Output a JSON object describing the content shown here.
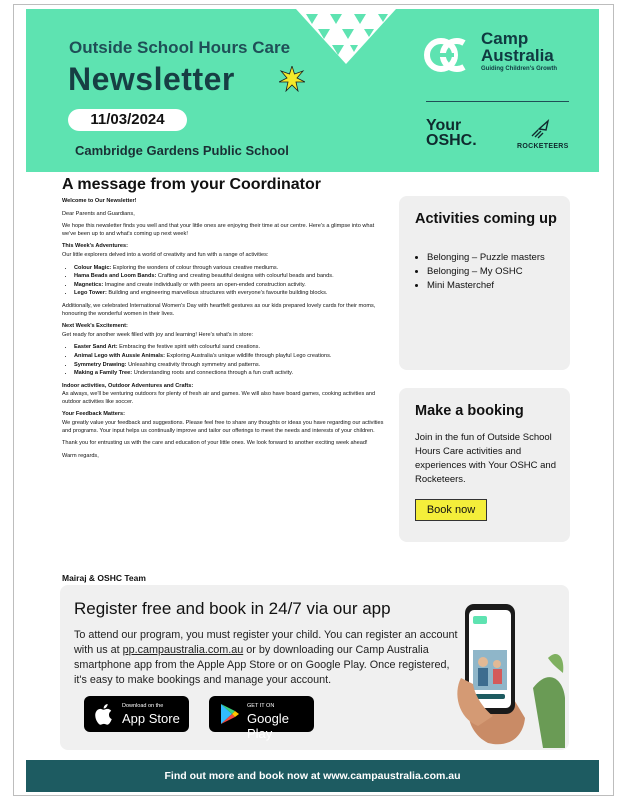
{
  "header": {
    "subtitle": "Outside School Hours Care",
    "title": "Newsletter",
    "date": "11/03/2024",
    "school": "Cambridge Gardens Public School",
    "brand_name_line1": "Camp",
    "brand_name_line2": "Australia",
    "brand_tagline": "Guiding Children's Growth",
    "your_oshc_line1": "Your",
    "your_oshc_line2": "OSHC.",
    "rocketeers": "ROCKETEERS",
    "bg_color": "#5ee3b1"
  },
  "coordinator": {
    "heading": "A message from your Coordinator",
    "welcome": "Welcome to Our Newsletter!",
    "greeting": "Dear Parents and Guardians,",
    "intro": "We hope this newsletter finds you well and that your little ones are enjoying their time at our centre. Here's a glimpse into what we've been up to and what's coming up next week!",
    "week_heading": "This Week's Adventures:",
    "week_intro": "Our little explorers delved into a world of creativity and fun with a range of activities:",
    "week_items": [
      {
        "title": "Colour Magic:",
        "text": " Exploring the wonders of colour through various creative mediums."
      },
      {
        "title": "Hama Beads and Loom Bands:",
        "text": " Crafting and creating beautiful designs with colourful beads and bands."
      },
      {
        "title": "Magnetics:",
        "text": " Imagine and create individually or with peers an open-ended construction activity."
      },
      {
        "title": "Lego Tower:",
        "text": " Building and engineering marvellous structures with everyone's favourite building blocks."
      }
    ],
    "womens_day": "Additionally, we celebrated International Women's Day with heartfelt gestures as our kids prepared lovely cards for their moms, honouring the wonderful women in their lives.",
    "next_heading": "Next Week's Excitement:",
    "next_intro": "Get ready for another week filled with joy and learning! Here's what's in store:",
    "next_items": [
      {
        "title": "Easter Sand Art:",
        "text": " Embracing the festive spirit with colourful sand creations."
      },
      {
        "title": "Animal Lego with Aussie Animals:",
        "text": " Exploring Australia's unique wildlife through playful Lego creations."
      },
      {
        "title": "Symmetry Drawing:",
        "text": " Unleashing creativity through symmetry and patterns."
      },
      {
        "title": "Making a Family Tree:",
        "text": " Understanding roots and connections through a fun craft activity."
      }
    ],
    "indoor_heading": "Indoor activities, Outdoor Adventures and Crafts:",
    "indoor_text": "As always, we'll be venturing outdoors for plenty of fresh air and games. We will also have board games, cooking activities and outdoor activities like soccer.",
    "feedback_heading": "Your Feedback Matters:",
    "feedback_text": "We greatly value your feedback and suggestions. Please feel free to share any thoughts or ideas you have regarding our activities and programs. Your input helps us continually improve and tailor our offerings to meet the needs and interests of your children.",
    "thanks": "Thank you for entrusting us with the care and education of your little ones. We look forward to another exciting week ahead!",
    "closing": "Warm regards,",
    "signature": "Mairaj & OSHC Team"
  },
  "activities": {
    "title": "Activities coming up",
    "items": [
      "Belonging – Puzzle masters",
      "Belonging – My OSHC",
      "Mini Masterchef"
    ]
  },
  "booking": {
    "title": "Make a booking",
    "text": "Join in the fun of Outside School Hours Care activities and experiences with Your OSHC and Rocketeers.",
    "button": "Book now",
    "button_color": "#f4ee3a"
  },
  "register": {
    "title": "Register free and book in 24/7 via our app",
    "text_before": "To attend our program, you must register your child. You can register an account with us at ",
    "link": "pp.campaustralia.com.au",
    "text_after": " or by downloading our Camp Australia smartphone app from the Apple App Store or on Google Play. Once registered, it's easy to make bookings and manage your account.",
    "apple_small": "Download on the",
    "apple_big": "App Store",
    "google_small": "GET IT ON",
    "google_big": "Google Play"
  },
  "footer": {
    "text": "Find out more and book now at www.campaustralia.com.au",
    "bg_color": "#1d5b61"
  }
}
